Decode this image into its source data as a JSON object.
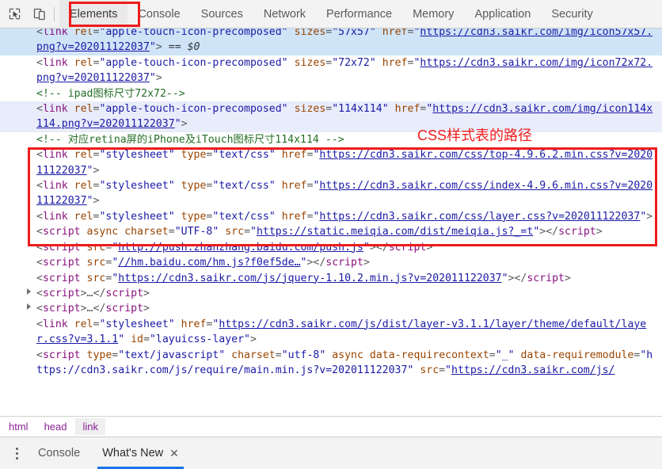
{
  "toolbar": {
    "icons": [
      {
        "name": "inspect-element-icon",
        "title": "Inspect element"
      },
      {
        "name": "device-toolbar-icon",
        "title": "Toggle device toolbar"
      }
    ],
    "tabs": [
      {
        "label": "Elements",
        "active": true
      },
      {
        "label": "Console",
        "active": false
      },
      {
        "label": "Sources",
        "active": false
      },
      {
        "label": "Network",
        "active": false
      },
      {
        "label": "Performance",
        "active": false
      },
      {
        "label": "Memory",
        "active": false
      },
      {
        "label": "Application",
        "active": false
      },
      {
        "label": "Security",
        "active": false
      }
    ]
  },
  "annotations": {
    "accent_color": "#ee1b1b",
    "css_path_label": "CSS样式表的路径",
    "elements_tab_box": true,
    "css_links_box": true
  },
  "code": {
    "rows": [
      {
        "id": "row-clipped-top",
        "state": "sel",
        "clipped": true,
        "tokens": [
          {
            "t": "punct",
            "v": "<"
          },
          {
            "t": "tag",
            "v": "link"
          },
          {
            "t": "attr",
            "v": " rel"
          },
          {
            "t": "eq",
            "v": "="
          },
          {
            "t": "val",
            "v": "\"apple-touch-icon-precomposed\""
          },
          {
            "t": "attr",
            "v": " sizes"
          },
          {
            "t": "eq",
            "v": "="
          },
          {
            "t": "val",
            "v": "\"57x57\""
          },
          {
            "t": "attr",
            "v": " href"
          },
          {
            "t": "eq",
            "v": "="
          },
          {
            "t": "val",
            "v": "\""
          },
          {
            "t": "link",
            "v": "https://cdn3.saikr.com/img/icon57x57.png?v=202011122037"
          },
          {
            "t": "val",
            "v": "\""
          },
          {
            "t": "punct",
            "v": ">"
          },
          {
            "t": "dollar",
            "v": " == $0"
          }
        ]
      },
      {
        "id": "row-icon72",
        "state": "none",
        "tokens": [
          {
            "t": "punct",
            "v": "<"
          },
          {
            "t": "tag",
            "v": "link"
          },
          {
            "t": "attr",
            "v": " rel"
          },
          {
            "t": "eq",
            "v": "="
          },
          {
            "t": "val",
            "v": "\"apple-touch-icon-precomposed\""
          },
          {
            "t": "attr",
            "v": " sizes"
          },
          {
            "t": "eq",
            "v": "="
          },
          {
            "t": "val",
            "v": "\"72x72\""
          },
          {
            "t": "attr",
            "v": " href"
          },
          {
            "t": "eq",
            "v": "="
          },
          {
            "t": "val",
            "v": "\""
          },
          {
            "t": "link",
            "v": "https://cdn3.saikr.com/img/icon72x72.png?v=202011122037"
          },
          {
            "t": "val",
            "v": "\""
          },
          {
            "t": "punct",
            "v": ">"
          }
        ]
      },
      {
        "id": "row-comment-ipad",
        "state": "none",
        "tokens": [
          {
            "t": "comment",
            "v": "<!-- ipad图标尺寸72x72-->"
          }
        ]
      },
      {
        "id": "row-icon114",
        "state": "hover",
        "tokens": [
          {
            "t": "punct",
            "v": "<"
          },
          {
            "t": "tag",
            "v": "link"
          },
          {
            "t": "attr",
            "v": " rel"
          },
          {
            "t": "eq",
            "v": "="
          },
          {
            "t": "val",
            "v": "\"apple-touch-icon-precomposed\""
          },
          {
            "t": "attr",
            "v": " sizes"
          },
          {
            "t": "eq",
            "v": "="
          },
          {
            "t": "val",
            "v": "\"114x114\""
          },
          {
            "t": "attr",
            "v": " href"
          },
          {
            "t": "eq",
            "v": "="
          },
          {
            "t": "val",
            "v": "\""
          },
          {
            "t": "link",
            "v": "https://cdn3.saikr.com/img/icon114x114.png?v=202011122037"
          },
          {
            "t": "val",
            "v": "\""
          },
          {
            "t": "punct",
            "v": ">"
          }
        ]
      },
      {
        "id": "row-comment-retina",
        "state": "none",
        "tokens": [
          {
            "t": "comment",
            "v": "<!-- 对应retina屏的iPhone及iTouch图标尺寸114x114 -->"
          }
        ]
      },
      {
        "id": "row-css-top",
        "state": "none",
        "tokens": [
          {
            "t": "punct",
            "v": "<"
          },
          {
            "t": "tag",
            "v": "link"
          },
          {
            "t": "attr",
            "v": " rel"
          },
          {
            "t": "eq",
            "v": "="
          },
          {
            "t": "val",
            "v": "\"stylesheet\""
          },
          {
            "t": "attr",
            "v": " type"
          },
          {
            "t": "eq",
            "v": "="
          },
          {
            "t": "val",
            "v": "\"text/css\""
          },
          {
            "t": "attr",
            "v": " href"
          },
          {
            "t": "eq",
            "v": "="
          },
          {
            "t": "val",
            "v": "\""
          },
          {
            "t": "link",
            "v": "https://cdn3.saikr.com/css/top-4.9.6.2.min.css?v=202011122037"
          },
          {
            "t": "val",
            "v": "\""
          },
          {
            "t": "punct",
            "v": ">"
          }
        ]
      },
      {
        "id": "row-css-index",
        "state": "none",
        "tokens": [
          {
            "t": "punct",
            "v": "<"
          },
          {
            "t": "tag",
            "v": "link"
          },
          {
            "t": "attr",
            "v": " rel"
          },
          {
            "t": "eq",
            "v": "="
          },
          {
            "t": "val",
            "v": "\"stylesheet\""
          },
          {
            "t": "attr",
            "v": " type"
          },
          {
            "t": "eq",
            "v": "="
          },
          {
            "t": "val",
            "v": "\"text/css\""
          },
          {
            "t": "attr",
            "v": " href"
          },
          {
            "t": "eq",
            "v": "="
          },
          {
            "t": "val",
            "v": "\""
          },
          {
            "t": "link",
            "v": "https://cdn3.saikr.com/css/index-4.9.6.min.css?v=202011122037"
          },
          {
            "t": "val",
            "v": "\""
          },
          {
            "t": "punct",
            "v": ">"
          }
        ]
      },
      {
        "id": "row-css-layer",
        "state": "none",
        "tokens": [
          {
            "t": "punct",
            "v": "<"
          },
          {
            "t": "tag",
            "v": "link"
          },
          {
            "t": "attr",
            "v": " rel"
          },
          {
            "t": "eq",
            "v": "="
          },
          {
            "t": "val",
            "v": "\"stylesheet\""
          },
          {
            "t": "attr",
            "v": " type"
          },
          {
            "t": "eq",
            "v": "="
          },
          {
            "t": "val",
            "v": "\"text/css\""
          },
          {
            "t": "attr",
            "v": " href"
          },
          {
            "t": "eq",
            "v": "="
          },
          {
            "t": "val",
            "v": "\""
          },
          {
            "t": "link",
            "v": "https://cdn3.saikr.com/css/layer.css?v=202011122037"
          },
          {
            "t": "val",
            "v": "\""
          },
          {
            "t": "punct",
            "v": ">"
          }
        ]
      },
      {
        "id": "row-script-meiqia",
        "state": "none",
        "tokens": [
          {
            "t": "punct",
            "v": "<"
          },
          {
            "t": "tag",
            "v": "script"
          },
          {
            "t": "attr",
            "v": " async"
          },
          {
            "t": "attr",
            "v": " charset"
          },
          {
            "t": "eq",
            "v": "="
          },
          {
            "t": "val",
            "v": "\"UTF-8\""
          },
          {
            "t": "attr",
            "v": " src"
          },
          {
            "t": "eq",
            "v": "="
          },
          {
            "t": "val",
            "v": "\""
          },
          {
            "t": "link",
            "v": "https://static.meiqia.com/dist/meiqia.js?_=t"
          },
          {
            "t": "val",
            "v": "\""
          },
          {
            "t": "punct",
            "v": "></"
          },
          {
            "t": "tag",
            "v": "script"
          },
          {
            "t": "punct",
            "v": ">"
          }
        ]
      },
      {
        "id": "row-script-baidu-push",
        "state": "none",
        "tokens": [
          {
            "t": "punct",
            "v": "<"
          },
          {
            "t": "tag",
            "v": "script"
          },
          {
            "t": "attr",
            "v": " src"
          },
          {
            "t": "eq",
            "v": "="
          },
          {
            "t": "val",
            "v": "\""
          },
          {
            "t": "link",
            "v": "http://push.zhanzhang.baidu.com/push.js"
          },
          {
            "t": "val",
            "v": "\""
          },
          {
            "t": "punct",
            "v": "></"
          },
          {
            "t": "tag",
            "v": "script"
          },
          {
            "t": "punct",
            "v": ">"
          }
        ]
      },
      {
        "id": "row-script-hm",
        "state": "none",
        "tokens": [
          {
            "t": "punct",
            "v": "<"
          },
          {
            "t": "tag",
            "v": "script"
          },
          {
            "t": "attr",
            "v": " src"
          },
          {
            "t": "eq",
            "v": "="
          },
          {
            "t": "val",
            "v": "\""
          },
          {
            "t": "link",
            "v": "//hm.baidu.com/hm.js?f0ef5de…"
          },
          {
            "t": "val",
            "v": "\""
          },
          {
            "t": "punct",
            "v": "></"
          },
          {
            "t": "tag",
            "v": "script"
          },
          {
            "t": "punct",
            "v": ">"
          }
        ]
      },
      {
        "id": "row-script-jquery",
        "state": "none",
        "tokens": [
          {
            "t": "punct",
            "v": "<"
          },
          {
            "t": "tag",
            "v": "script"
          },
          {
            "t": "attr",
            "v": " src"
          },
          {
            "t": "eq",
            "v": "="
          },
          {
            "t": "val",
            "v": "\""
          },
          {
            "t": "link",
            "v": "https://cdn3.saikr.com/js/jquery-1.10.2.min.js?v=202011122037"
          },
          {
            "t": "val",
            "v": "\""
          },
          {
            "t": "punct",
            "v": "></"
          },
          {
            "t": "tag",
            "v": "script"
          },
          {
            "t": "punct",
            "v": ">"
          }
        ]
      },
      {
        "id": "row-script-collapsed-1",
        "state": "none",
        "arrow": true,
        "tokens": [
          {
            "t": "punct",
            "v": "<"
          },
          {
            "t": "tag",
            "v": "script"
          },
          {
            "t": "punct",
            "v": ">"
          },
          {
            "t": "ellip",
            "v": "…"
          },
          {
            "t": "punct",
            "v": "</"
          },
          {
            "t": "tag",
            "v": "script"
          },
          {
            "t": "punct",
            "v": ">"
          }
        ]
      },
      {
        "id": "row-script-collapsed-2",
        "state": "none",
        "arrow": true,
        "tokens": [
          {
            "t": "punct",
            "v": "<"
          },
          {
            "t": "tag",
            "v": "script"
          },
          {
            "t": "punct",
            "v": ">"
          },
          {
            "t": "ellip",
            "v": "…"
          },
          {
            "t": "punct",
            "v": "</"
          },
          {
            "t": "tag",
            "v": "script"
          },
          {
            "t": "punct",
            "v": ">"
          }
        ]
      },
      {
        "id": "row-layui-css",
        "state": "none",
        "tokens": [
          {
            "t": "punct",
            "v": "<"
          },
          {
            "t": "tag",
            "v": "link"
          },
          {
            "t": "attr",
            "v": " rel"
          },
          {
            "t": "eq",
            "v": "="
          },
          {
            "t": "val",
            "v": "\"stylesheet\""
          },
          {
            "t": "attr",
            "v": " href"
          },
          {
            "t": "eq",
            "v": "="
          },
          {
            "t": "val",
            "v": "\""
          },
          {
            "t": "link",
            "v": "https://cdn3.saikr.com/js/dist/layer-v3.1.1/layer/theme/default/layer.css?v=3.1.1"
          },
          {
            "t": "val",
            "v": "\""
          },
          {
            "t": "attr",
            "v": " id"
          },
          {
            "t": "eq",
            "v": "="
          },
          {
            "t": "val",
            "v": "\"layuicss-layer\""
          },
          {
            "t": "punct",
            "v": ">"
          }
        ]
      },
      {
        "id": "row-script-requirejs",
        "state": "none",
        "tokens": [
          {
            "t": "punct",
            "v": "<"
          },
          {
            "t": "tag",
            "v": "script"
          },
          {
            "t": "attr",
            "v": " type"
          },
          {
            "t": "eq",
            "v": "="
          },
          {
            "t": "val",
            "v": "\"text/javascript\""
          },
          {
            "t": "attr",
            "v": " charset"
          },
          {
            "t": "eq",
            "v": "="
          },
          {
            "t": "val",
            "v": "\"utf-8\""
          },
          {
            "t": "attr",
            "v": " async"
          },
          {
            "t": "attr",
            "v": " data-requirecontext"
          },
          {
            "t": "eq",
            "v": "="
          },
          {
            "t": "val",
            "v": "\"_\""
          },
          {
            "t": "attr",
            "v": " data-requiremodule"
          },
          {
            "t": "eq",
            "v": "="
          },
          {
            "t": "val",
            "v": "\"https://cdn3.saikr.com/js/require/main.min.js?v=202011122037\""
          },
          {
            "t": "attr",
            "v": " src"
          },
          {
            "t": "eq",
            "v": "="
          },
          {
            "t": "val",
            "v": "\""
          },
          {
            "t": "link",
            "v": "https://cdn3.saikr.com/js/"
          }
        ]
      }
    ]
  },
  "breadcrumb": {
    "items": [
      {
        "label": "html",
        "active": false
      },
      {
        "label": "head",
        "active": false
      },
      {
        "label": "link",
        "active": true
      }
    ]
  },
  "drawer": {
    "menu_icon": "kebab-menu-icon",
    "tabs": [
      {
        "label": "Console",
        "active": false,
        "closable": false
      },
      {
        "label": "What's New",
        "active": true,
        "closable": true,
        "close_glyph": "✕"
      }
    ]
  }
}
